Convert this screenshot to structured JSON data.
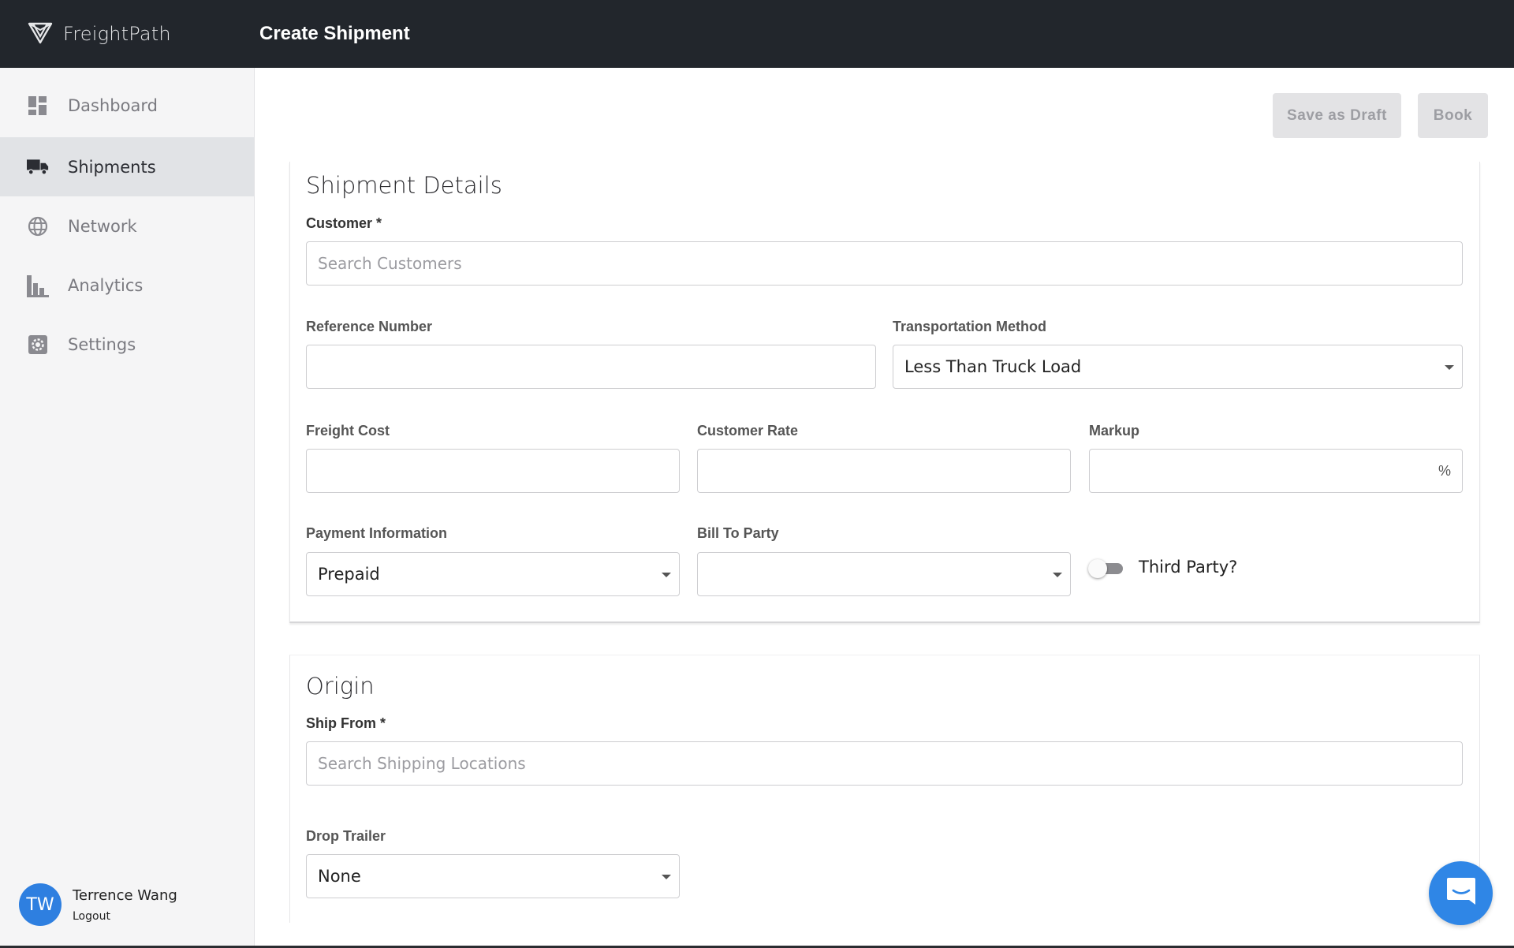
{
  "app": {
    "brand_name": "FreightPath",
    "page_title": "Create Shipment"
  },
  "sidebar": {
    "items": [
      {
        "label": "Dashboard",
        "icon": "dashboard-icon",
        "active": false
      },
      {
        "label": "Shipments",
        "icon": "truck-icon",
        "active": true
      },
      {
        "label": "Network",
        "icon": "globe-icon",
        "active": false
      },
      {
        "label": "Analytics",
        "icon": "bar-chart-icon",
        "active": false
      },
      {
        "label": "Settings",
        "icon": "gear-icon",
        "active": false
      }
    ],
    "user": {
      "initials": "TW",
      "name": "Terrence Wang",
      "logout_label": "Logout"
    }
  },
  "toolbar": {
    "save_draft_label": "Save as Draft",
    "book_label": "Book"
  },
  "shipment_details": {
    "title": "Shipment Details",
    "customer_label": "Customer *",
    "customer_placeholder": "Search Customers",
    "reference_label": "Reference Number",
    "reference_value": "",
    "transport_label": "Transportation Method",
    "transport_value": "Less Than Truck Load",
    "freight_cost_label": "Freight Cost",
    "customer_rate_label": "Customer Rate",
    "markup_label": "Markup",
    "markup_suffix": "%",
    "payment_label": "Payment Information",
    "payment_value": "Prepaid",
    "bill_to_label": "Bill To Party",
    "bill_to_value": "",
    "third_party_label": "Third Party?",
    "third_party_on": false
  },
  "origin": {
    "title": "Origin",
    "ship_from_label": "Ship From *",
    "ship_from_placeholder": "Search Shipping Locations",
    "drop_trailer_label": "Drop Trailer",
    "drop_trailer_value": "None"
  },
  "colors": {
    "topbar": "#22262c",
    "accent": "#2e7fe0",
    "chat_button": "#2f86e6"
  }
}
